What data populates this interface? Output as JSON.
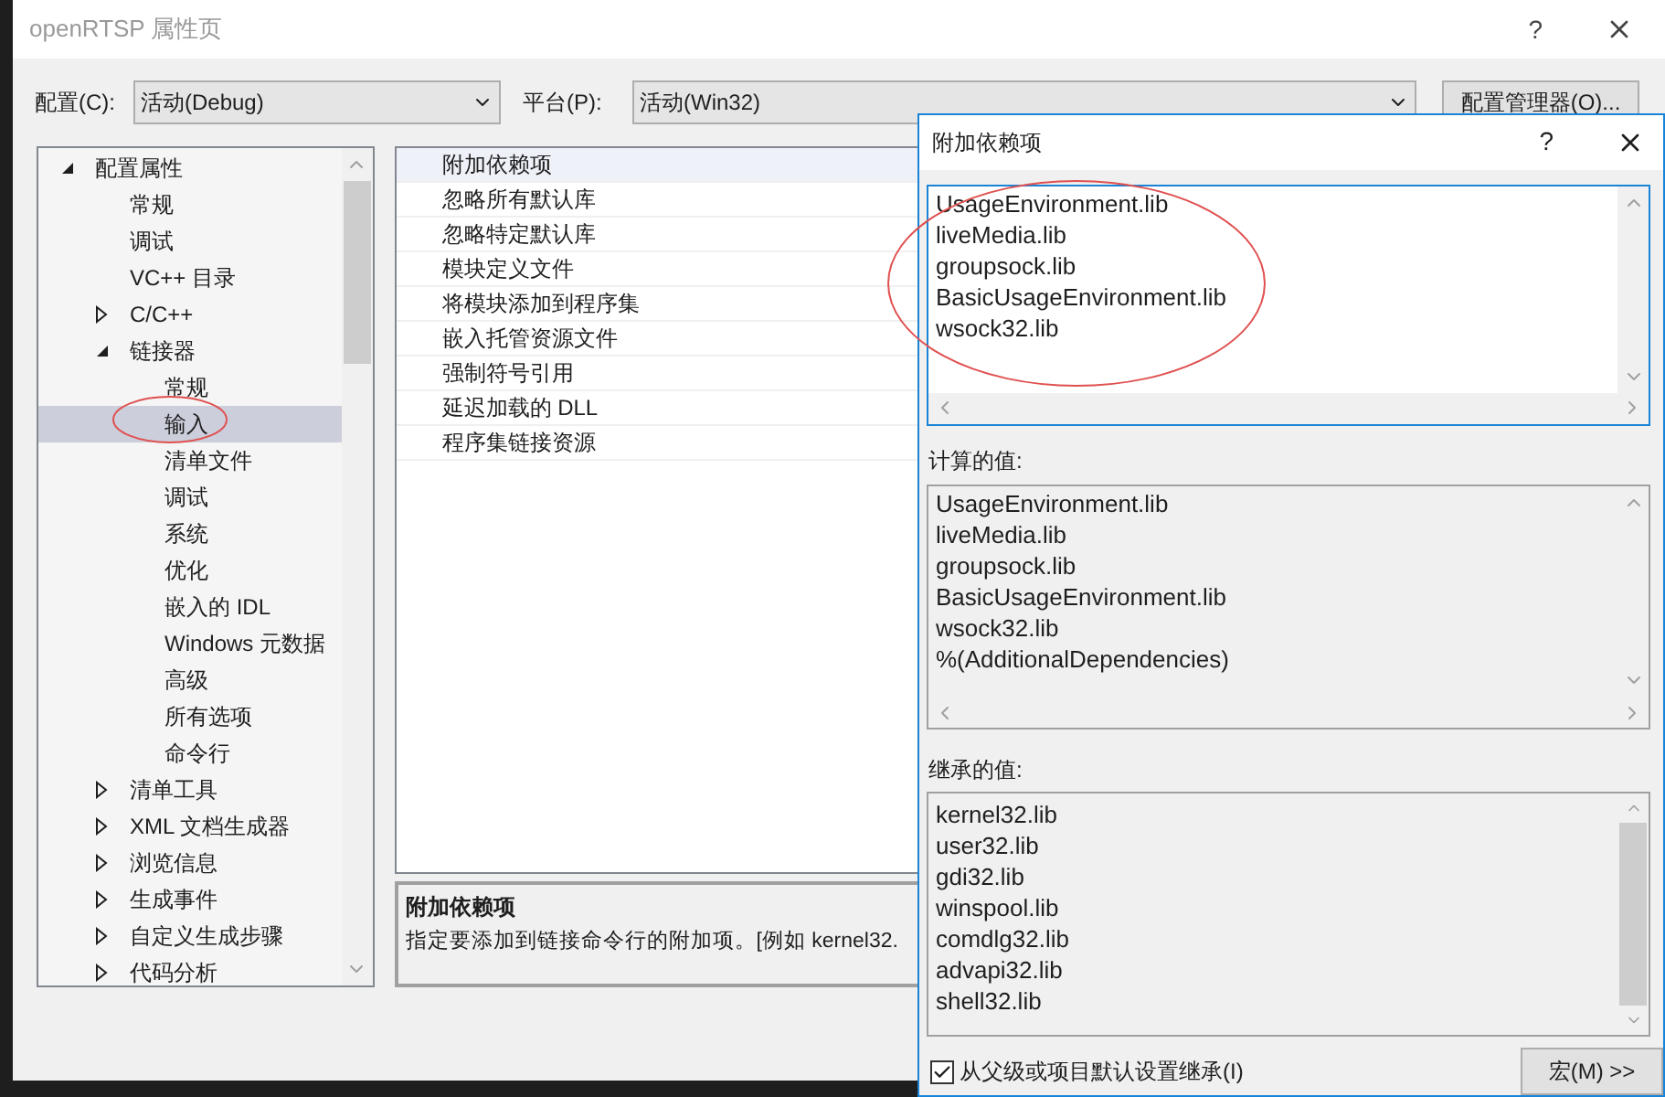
{
  "window": {
    "title": "openRTSP 属性页",
    "help": "?"
  },
  "config": {
    "label": "配置(C):",
    "value": "活动(Debug)"
  },
  "platform": {
    "label": "平台(P):",
    "value": "活动(Win32)"
  },
  "config_manager_button": "配置管理器(O)...",
  "tree": [
    {
      "label": "配置属性",
      "kind": "group",
      "expanded": true,
      "selected": false,
      "children": [
        {
          "label": "常规",
          "kind": "leaf",
          "selected": false
        },
        {
          "label": "调试",
          "kind": "leaf",
          "selected": false
        },
        {
          "label": "VC++ 目录",
          "kind": "leaf",
          "selected": false
        },
        {
          "label": "C/C++",
          "kind": "group",
          "expanded": false,
          "selected": false
        },
        {
          "label": "链接器",
          "kind": "group",
          "expanded": true,
          "selected": false,
          "children": [
            {
              "label": "常规",
              "kind": "leaf",
              "selected": false
            },
            {
              "label": "输入",
              "kind": "leaf",
              "selected": true
            },
            {
              "label": "清单文件",
              "kind": "leaf",
              "selected": false
            },
            {
              "label": "调试",
              "kind": "leaf",
              "selected": false
            },
            {
              "label": "系统",
              "kind": "leaf",
              "selected": false
            },
            {
              "label": "优化",
              "kind": "leaf",
              "selected": false
            },
            {
              "label": "嵌入的 IDL",
              "kind": "leaf",
              "selected": false
            },
            {
              "label": "Windows 元数据",
              "kind": "leaf",
              "selected": false
            },
            {
              "label": "高级",
              "kind": "leaf",
              "selected": false
            },
            {
              "label": "所有选项",
              "kind": "leaf",
              "selected": false
            },
            {
              "label": "命令行",
              "kind": "leaf",
              "selected": false
            }
          ]
        },
        {
          "label": "清单工具",
          "kind": "group",
          "expanded": false,
          "selected": false
        },
        {
          "label": "XML 文档生成器",
          "kind": "group",
          "expanded": false,
          "selected": false
        },
        {
          "label": "浏览信息",
          "kind": "group",
          "expanded": false,
          "selected": false
        },
        {
          "label": "生成事件",
          "kind": "group",
          "expanded": false,
          "selected": false
        },
        {
          "label": "自定义生成步骤",
          "kind": "group",
          "expanded": false,
          "selected": false
        },
        {
          "label": "代码分析",
          "kind": "group",
          "expanded": false,
          "selected": false
        }
      ]
    }
  ],
  "properties": [
    {
      "label": "附加依赖项",
      "selected": true
    },
    {
      "label": "忽略所有默认库",
      "selected": false
    },
    {
      "label": "忽略特定默认库",
      "selected": false
    },
    {
      "label": "模块定义文件",
      "selected": false
    },
    {
      "label": "将模块添加到程序集",
      "selected": false
    },
    {
      "label": "嵌入托管资源文件",
      "selected": false
    },
    {
      "label": "强制符号引用",
      "selected": false
    },
    {
      "label": "延迟加载的 DLL",
      "selected": false
    },
    {
      "label": "程序集链接资源",
      "selected": false
    }
  ],
  "description": {
    "title": "附加依赖项",
    "text": "指定要添加到链接命令行的附加项。[例如 kernel32."
  },
  "dialog": {
    "title": "附加依赖项",
    "help": "?",
    "edit_lines": [
      "UsageEnvironment.lib",
      "liveMedia.lib",
      "groupsock.lib",
      "BasicUsageEnvironment.lib",
      "wsock32.lib"
    ],
    "computed_label": "计算的值:",
    "computed_lines": [
      "UsageEnvironment.lib",
      "liveMedia.lib",
      "groupsock.lib",
      "BasicUsageEnvironment.lib",
      "wsock32.lib",
      "%(AdditionalDependencies)"
    ],
    "inherited_label": "继承的值:",
    "inherited_lines": [
      "kernel32.lib",
      "user32.lib",
      "gdi32.lib",
      "winspool.lib",
      "comdlg32.lib",
      "advapi32.lib",
      "shell32.lib"
    ],
    "inherit_checkbox": {
      "label": "从父级或项目默认设置继承(I)",
      "checked": true
    },
    "macro_button": "宏(M) >>"
  }
}
